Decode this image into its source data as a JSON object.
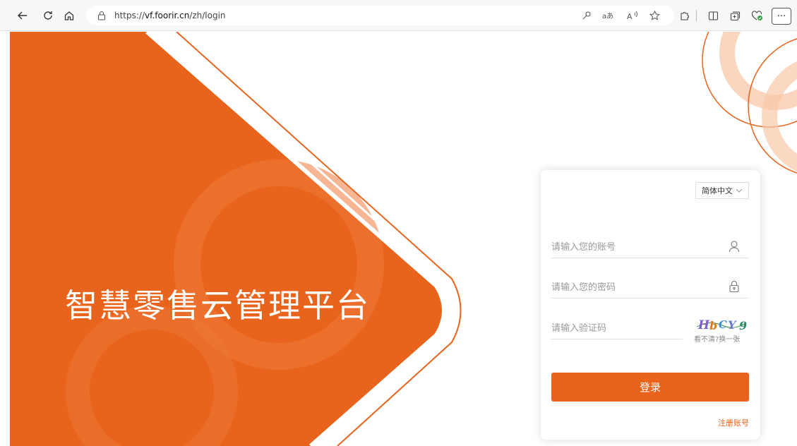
{
  "browser": {
    "url_prefix": "https://",
    "url_host": "vf.foorir.cn",
    "url_path": "/zh/login",
    "back_icon": "arrow-left-icon",
    "refresh_icon": "refresh-icon",
    "home_icon": "home-icon",
    "menu_label": "···"
  },
  "colors": {
    "brand": "#e8641c",
    "brand_dark": "#d4541a"
  },
  "hero": {
    "title": "智慧零售云管理平台"
  },
  "login": {
    "language": "简体中文",
    "account_placeholder": "请输入您的账号",
    "password_placeholder": "请输入您的密码",
    "captcha_placeholder": "请输入验证码",
    "captcha_text": "HbCY9",
    "captcha_refresh": "看不清?换一张",
    "submit_label": "登录",
    "register_link": "注册账号"
  }
}
